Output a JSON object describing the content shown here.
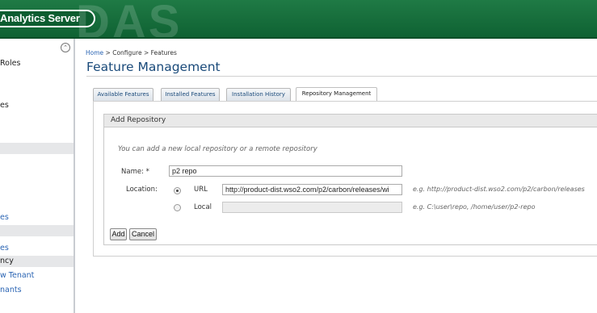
{
  "header": {
    "brand": "Analytics Server",
    "watermark": "DAS"
  },
  "sidebar": {
    "collapse_icon": "chevron-up-icon",
    "items": [
      {
        "label": "Roles"
      },
      {
        "label": "es"
      },
      {
        "label": ""
      },
      {
        "label": "es"
      },
      {
        "label": ""
      },
      {
        "label": "es"
      },
      {
        "label": "ncy"
      },
      {
        "label": "w Tenant"
      },
      {
        "label": "nants"
      }
    ]
  },
  "breadcrumb": {
    "home": "Home",
    "rest": " > Configure > Features"
  },
  "page_title": "Feature Management",
  "tabs": [
    {
      "label": "Available Features"
    },
    {
      "label": "Installed Features"
    },
    {
      "label": "Installation History"
    },
    {
      "label": "Repository Management"
    }
  ],
  "add_repository": {
    "title": "Add Repository",
    "info": "You can add a new local repository or a remote repository",
    "name_label": "Name: *",
    "name_value": "p2 repo",
    "location_label": "Location:",
    "url_option": "URL",
    "url_value": "http://product-dist.wso2.com/p2/carbon/releases/wi",
    "url_hint": "e.g. http://product-dist.wso2.com/p2/carbon/releases",
    "local_option": "Local",
    "local_value": "",
    "local_hint": "e.g. C:\\user\\repo, /home/user/p2-repo",
    "add_button": "Add",
    "cancel_button": "Cancel"
  }
}
